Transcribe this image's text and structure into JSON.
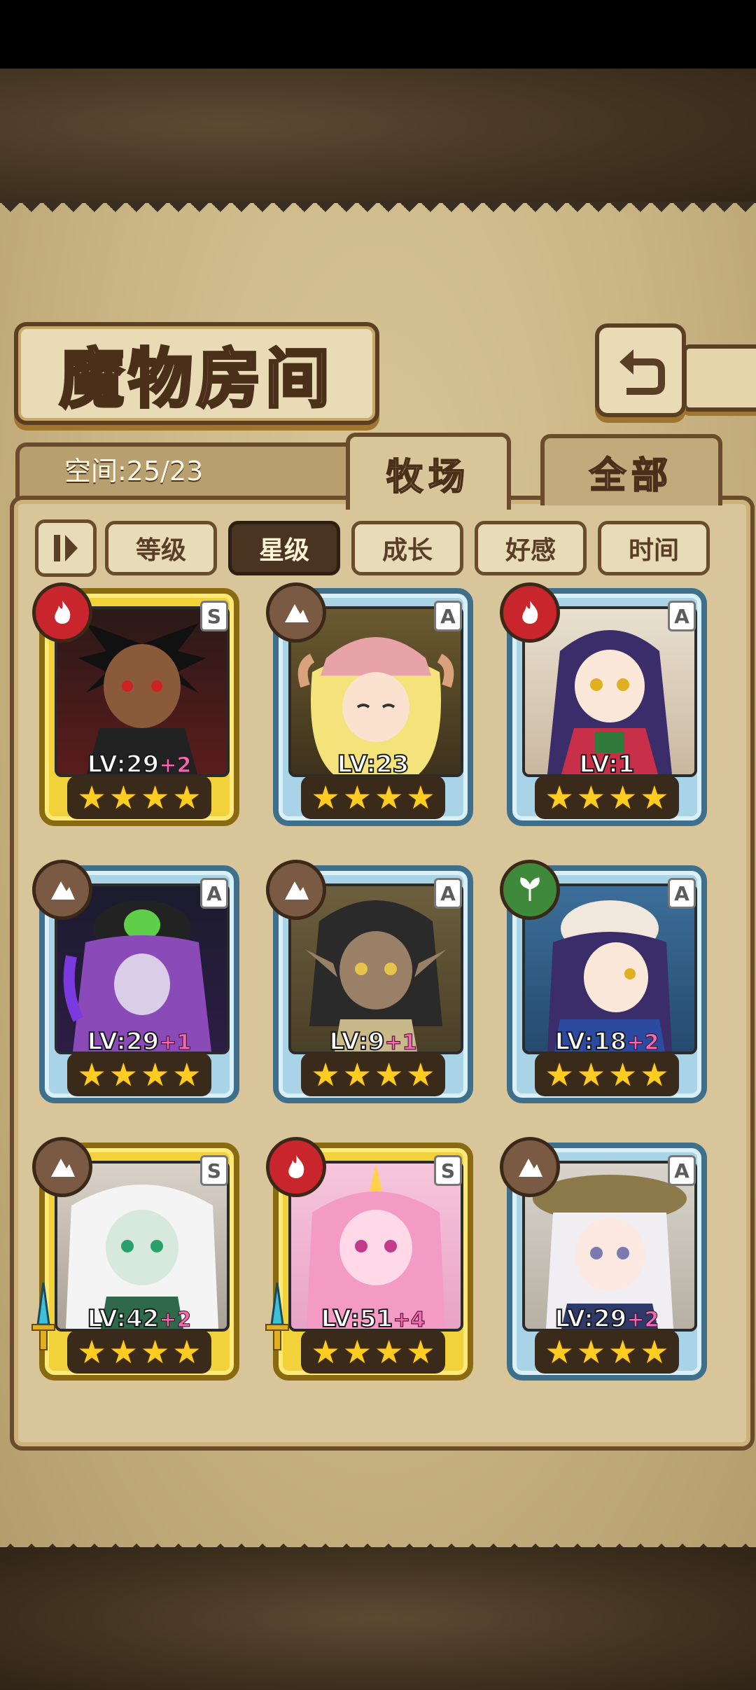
{
  "title": "魔物房间",
  "capacity": "空间:25/23",
  "tabs": {
    "ranch": "牧场",
    "all": "全部"
  },
  "sort_buttons": [
    "等级",
    "星级",
    "成长",
    "好感",
    "时间"
  ],
  "active_sort": "星级",
  "colors": {
    "fire": "#c8262c",
    "earth": "#7a5a42",
    "wood": "#3e8a3a",
    "gold_frame": "#f2d23a",
    "blue_frame": "#a9d3e6"
  },
  "monsters": [
    {
      "level": "LV:29",
      "bonus": "+2",
      "rank": "S",
      "element": "fire-icon",
      "stars": 4
    },
    {
      "level": "LV:23",
      "bonus": "",
      "rank": "A",
      "element": "earth-icon",
      "stars": 4
    },
    {
      "level": "LV:1",
      "bonus": "",
      "rank": "A",
      "element": "fire-icon",
      "stars": 4
    },
    {
      "level": "LV:29",
      "bonus": "+1",
      "rank": "A",
      "element": "earth-icon",
      "stars": 4
    },
    {
      "level": "LV:9",
      "bonus": "+1",
      "rank": "A",
      "element": "earth-icon",
      "stars": 4
    },
    {
      "level": "LV:18",
      "bonus": "+2",
      "rank": "A",
      "element": "wood-icon",
      "stars": 4
    },
    {
      "level": "LV:42",
      "bonus": "+2",
      "rank": "S",
      "element": "earth-icon",
      "stars": 4
    },
    {
      "level": "LV:51",
      "bonus": "+4",
      "rank": "S",
      "element": "fire-icon",
      "stars": 4
    },
    {
      "level": "LV:29",
      "bonus": "+2",
      "rank": "A",
      "element": "earth-icon",
      "stars": 4
    }
  ]
}
